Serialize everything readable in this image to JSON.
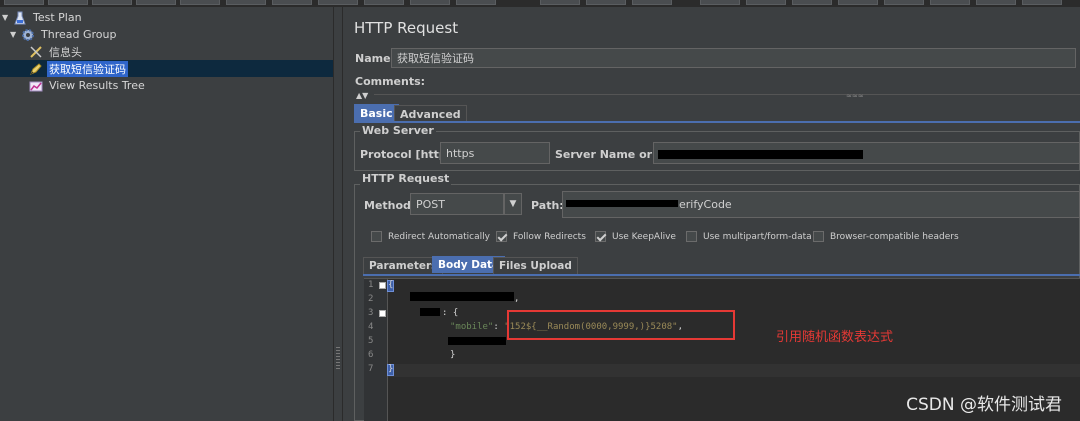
{
  "tree": {
    "items": [
      {
        "label": "Test Plan",
        "icon": "test-plan-icon"
      },
      {
        "label": "Thread Group",
        "icon": "gear-icon"
      },
      {
        "label": "信息头",
        "icon": "header-manager-icon"
      },
      {
        "label": "获取短信验证码",
        "icon": "sampler-pencil-icon"
      },
      {
        "label": "View Results Tree",
        "icon": "chart-icon"
      }
    ]
  },
  "panel": {
    "title": "HTTP Request",
    "name_label": "Name:",
    "name_value": "获取短信验证码",
    "comments_label": "Comments:",
    "tabs": [
      "Basic",
      "Advanced"
    ],
    "web_server": {
      "title": "Web Server",
      "protocol_label": "Protocol [http]:",
      "protocol_value": "https",
      "server_label": "Server Name or IP:"
    },
    "http_request": {
      "title": "HTTP Request",
      "method_label": "Method:",
      "method_value": "POST",
      "path_label": "Path:",
      "path_value": "erifyCode"
    },
    "checkboxes": [
      {
        "label": "Redirect Automatically",
        "checked": false
      },
      {
        "label": "Follow Redirects",
        "checked": true
      },
      {
        "label": "Use KeepAlive",
        "checked": true
      },
      {
        "label": "Use multipart/form-data",
        "checked": false
      },
      {
        "label": "Browser-compatible headers",
        "checked": false
      }
    ],
    "body_tabs": [
      "Parameters",
      "Body Data",
      "Files Upload"
    ],
    "active_body_tab": "Body Data"
  },
  "editor": {
    "line_numbers": [
      "1",
      "2",
      "3",
      "4",
      "5",
      "6",
      "7"
    ],
    "line1": "{",
    "line2_suffix": ",",
    "line3_suffix": ": {",
    "line4_key": "\"mobile\"",
    "line4_colon": ": ",
    "line4_value": "\"152${__Random(0000,9999,)}5208\"",
    "line4_comma": ",",
    "line6": "}",
    "line7": "}"
  },
  "annotation": "引用随机函数表达式",
  "watermark": "CSDN @软件测试君",
  "colors": {
    "accent": "#4b6eaf",
    "annotation": "#e53935",
    "selection": "#2f65ca"
  }
}
